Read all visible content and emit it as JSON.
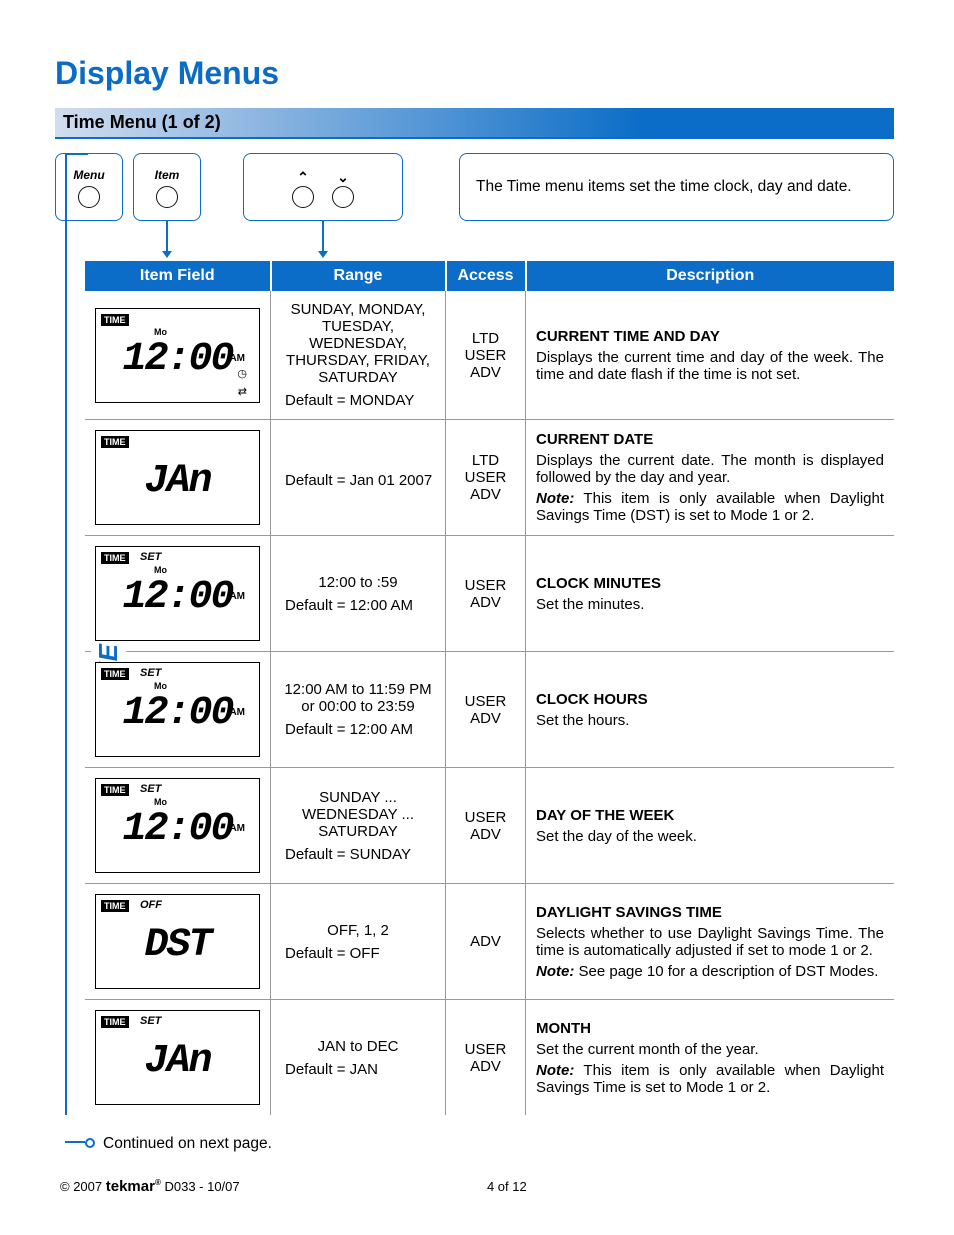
{
  "page": {
    "title": "Display Menus",
    "section_title": "Time Menu (1 of 2)",
    "intro_text": "The Time menu items set the time clock, day and date.",
    "menu_btn_label": "Menu",
    "item_btn_label": "Item",
    "continued_text": "Continued on next page.",
    "side_label": "TIME MENU"
  },
  "headers": {
    "item_field": "Item Field",
    "range": "Range",
    "access": "Access",
    "description": "Description"
  },
  "rows": [
    {
      "lcd": {
        "badge": "TIME",
        "tag": "",
        "day": "Mo",
        "seg": "12:00",
        "ampm": "AM",
        "clock": true,
        "arrows": true
      },
      "range": "SUNDAY, MONDAY, TUESDAY, WEDNESDAY, THURSDAY, FRIDAY, SATURDAY",
      "default": "Default = MONDAY",
      "access": "LTD\nUSER\nADV",
      "desc_title": "CURRENT TIME AND DAY",
      "desc_body": "Displays the current time and day of the week. The time and date flash if the time is not set.",
      "note": ""
    },
    {
      "lcd": {
        "badge": "TIME",
        "tag": "",
        "day": "",
        "seg": "JAn",
        "ampm": "",
        "clock": false,
        "arrows": false
      },
      "range": "",
      "default": "Default = Jan 01 2007",
      "access": "LTD\nUSER\nADV",
      "desc_title": "CURRENT DATE",
      "desc_body": "Displays the current date. The month is displayed followed by the day and year.",
      "note": "This item is only available when Daylight Savings Time (DST) is set to Mode 1 or 2."
    },
    {
      "lcd": {
        "badge": "TIME",
        "tag": "SET",
        "day": "Mo",
        "seg": "12:00",
        "ampm": "AM",
        "clock": false,
        "arrows": false
      },
      "range": "12:00 to :59",
      "default": "Default = 12:00 AM",
      "access": "USER\nADV",
      "desc_title": "CLOCK MINUTES",
      "desc_body": "Set the minutes.",
      "note": ""
    },
    {
      "lcd": {
        "badge": "TIME",
        "tag": "SET",
        "day": "Mo",
        "seg": "12:00",
        "ampm": "AM",
        "clock": false,
        "arrows": false
      },
      "range": "12:00 AM to 11:59 PM or 00:00 to 23:59",
      "default": "Default = 12:00 AM",
      "access": "USER\nADV",
      "desc_title": "CLOCK HOURS",
      "desc_body": "Set the hours.",
      "note": ""
    },
    {
      "lcd": {
        "badge": "TIME",
        "tag": "SET",
        "day": "Mo",
        "seg": "12:00",
        "ampm": "AM",
        "clock": false,
        "arrows": false
      },
      "range": "SUNDAY ... WEDNESDAY ... SATURDAY",
      "default": "Default = SUNDAY",
      "access": "USER\nADV",
      "desc_title": "DAY OF THE WEEK",
      "desc_body": "Set the day of the week.",
      "note": ""
    },
    {
      "lcd": {
        "badge": "TIME",
        "tag": "OFF",
        "day": "",
        "seg": "DST",
        "ampm": "",
        "clock": false,
        "arrows": false
      },
      "range": "OFF, 1, 2",
      "default": "Default = OFF",
      "access": "ADV",
      "desc_title": "DAYLIGHT SAVINGS TIME",
      "desc_body": "Selects whether to use Daylight Savings Time.  The time is automatically adjusted if set to mode 1 or 2.",
      "note": "See page 10 for a description of DST Modes."
    },
    {
      "lcd": {
        "badge": "TIME",
        "tag": "SET",
        "day": "",
        "seg": "JAn",
        "ampm": "",
        "clock": false,
        "arrows": false
      },
      "range": "JAN to DEC",
      "default": "Default = JAN",
      "access": "USER\nADV",
      "desc_title": "MONTH",
      "desc_body": "Set the current month of the year.",
      "note": "This item is only available when Daylight Savings Time is set to Mode 1 or 2."
    }
  ],
  "footer": {
    "copyright": "© 2007 ",
    "brand": "tekmar",
    "doc": " D033 - 10/07",
    "page": "4 of 12"
  }
}
